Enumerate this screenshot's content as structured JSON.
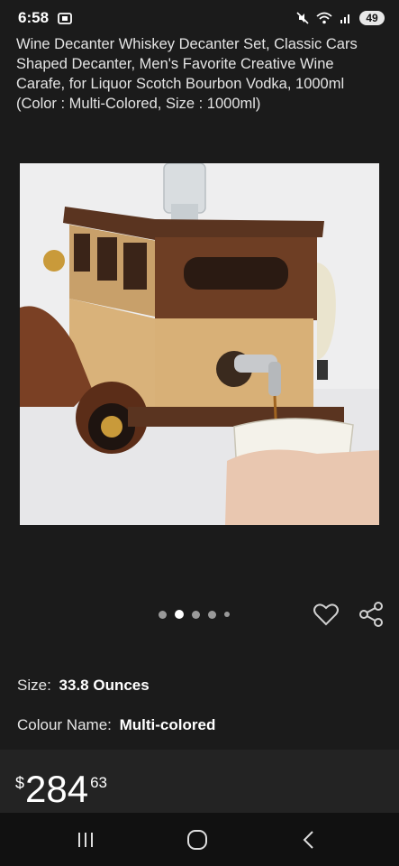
{
  "status_bar": {
    "time": "6:58",
    "battery_level": "49",
    "icons": [
      "screenshot-icon",
      "mute-icon",
      "wifi-icon",
      "signal-icon",
      "battery-icon"
    ]
  },
  "product": {
    "title": "Wine Decanter Whiskey Decanter Set, Classic Cars Shaped Decanter, Men's Favorite Creative Wine Carafe, for Liquor Scotch Bourbon Vodka, 1000ml (Color : Multi-Colored, Size : 1000ml)",
    "image_subject": "wooden classic car decanter with tap pouring into glass",
    "carousel": {
      "total": 5,
      "active_index": 1
    },
    "attributes": [
      {
        "label": "Size:",
        "value": "33.8 Ounces"
      },
      {
        "label": "Colour Name:",
        "value": "Multi-colored"
      }
    ],
    "price": {
      "symbol": "$",
      "whole": "284",
      "fraction": "63"
    }
  },
  "actions": [
    "heart-icon",
    "share-icon"
  ],
  "nav_bar": [
    "recent-apps-icon",
    "home-icon",
    "back-icon"
  ],
  "colors": {
    "background": "#1b1b1b",
    "text": "#e6e6e6",
    "nav_bar": "#111111"
  }
}
